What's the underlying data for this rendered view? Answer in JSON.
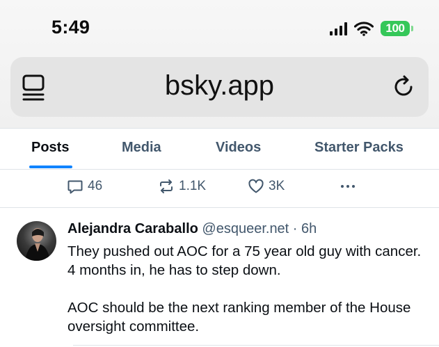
{
  "status_bar": {
    "time": "5:49",
    "battery": "100"
  },
  "browser": {
    "url": "bsky.app"
  },
  "profile_tabs": [
    "Posts",
    "Media",
    "Videos",
    "Starter Packs"
  ],
  "post_actions": {
    "replies": "46",
    "reposts": "1.1K",
    "likes": "3K"
  },
  "post": {
    "author": "Alejandra Caraballo",
    "handle": "@esqueer.net",
    "separator": " · ",
    "time": "6h",
    "paragraphs": [
      "They pushed out AOC for a 75 year old guy with cancer. 4 months in, he has to step down.",
      "AOC should be the next ranking member of the House oversight committee."
    ]
  },
  "colors": {
    "accent": "#1083fe",
    "secondary_text": "#42576c",
    "battery": "#35c759"
  }
}
